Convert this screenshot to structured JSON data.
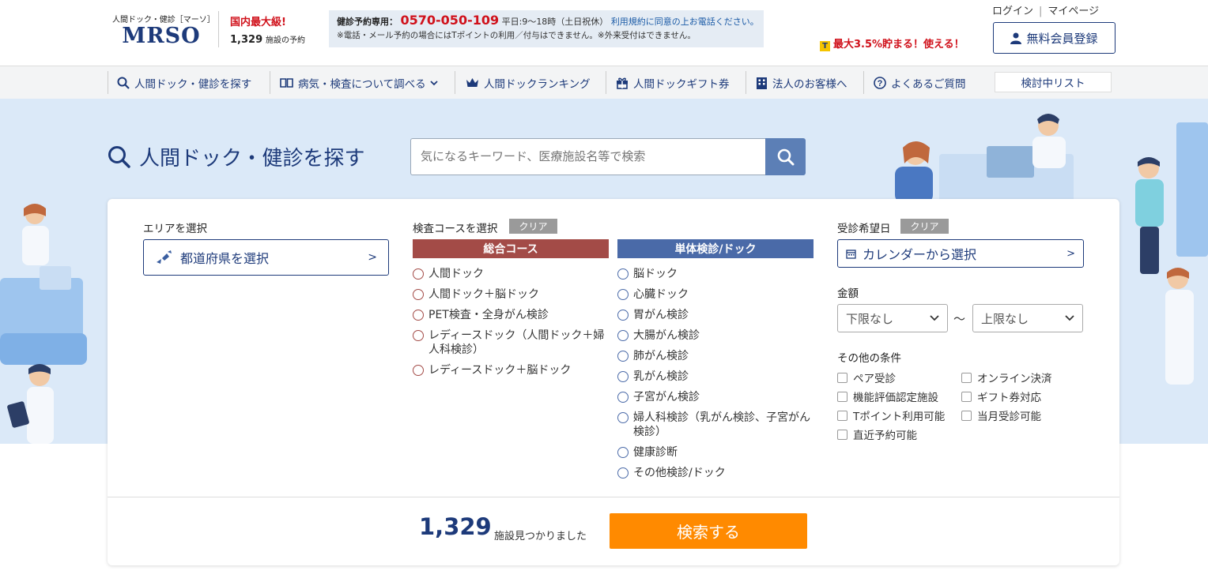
{
  "header": {
    "logo_sub": "人間ドック・健診［マーソ］",
    "logo_main": "MRSO",
    "badge_title": "国内最大級!",
    "badge_count": "1,329",
    "badge_count_suffix": "施設の予約",
    "phone_label": "健診予約専用：",
    "phone_number": "0570-050-109",
    "phone_hours": "平日:9～18時（土日祝休）",
    "phone_agree": "利用規約に同意の上お電話ください。",
    "phone_note": "※電話・メール予約の場合にはTポイントの利用／付与はできません。※外来受付はできません。",
    "login": "ログイン",
    "separator": "|",
    "mypage": "マイページ",
    "tpoint_icon": "T",
    "tpoint_text": "最大3.5%貯まる！使える！",
    "register": "無料会員登録"
  },
  "nav": {
    "items": [
      {
        "label": "人間ドック・健診を探す",
        "icon": "search-icon"
      },
      {
        "label": "病気・検査について調べる",
        "icon": "book-icon"
      },
      {
        "label": "人間ドックランキング",
        "icon": "crown-icon"
      },
      {
        "label": "人間ドックギフト券",
        "icon": "gift-icon"
      },
      {
        "label": "法人のお客様へ",
        "icon": "building-icon"
      },
      {
        "label": "よくあるご質問",
        "icon": "question-icon"
      }
    ],
    "list_button": "検討中リスト"
  },
  "hero": {
    "title": "人間ドック・健診を探す",
    "search_placeholder": "気になるキーワード、医療施設名等で検索"
  },
  "search_panel": {
    "area_label": "エリアを選択",
    "area_button": "都道府県を選択",
    "course_label": "検査コースを選択",
    "clear": "クリア",
    "chevron": ">",
    "general_head": "総合コース",
    "general_items": [
      "人間ドック",
      "人間ドック＋脳ドック",
      "PET検査・全身がん検診",
      "レディースドック（人間ドック＋婦人科検診）",
      "レディースドック＋脳ドック"
    ],
    "single_head": "単体検診/ドック",
    "single_items": [
      "脳ドック",
      "心臓ドック",
      "胃がん検診",
      "大腸がん検診",
      "肺がん検診",
      "乳がん検診",
      "子宮がん検診",
      "婦人科検診（乳がん検診、子宮がん検診）",
      "健康診断",
      "その他検診/ドック"
    ],
    "date_label": "受診希望日",
    "calendar_button": "カレンダーから選択",
    "price_label": "金額",
    "price_min": "下限なし",
    "price_max": "上限なし",
    "tilde": "～",
    "other_label": "その他の条件",
    "conditions": [
      "ペア受診",
      "オンライン決済",
      "機能評価認定施設",
      "ギフト券対応",
      "Tポイント利用可能",
      "当月受診可能",
      "直近予約可能"
    ],
    "result_count": "1,329",
    "result_text": "施設見つかりました",
    "submit": "検索する"
  },
  "colors": {
    "brand_navy": "#1d3a7a",
    "accent_red": "#d0111b",
    "general_head_bg": "#a34b47",
    "single_head_bg": "#4a6aa8",
    "submit_bg": "#ff8a00",
    "hero_bg": "#dbe9f8"
  }
}
